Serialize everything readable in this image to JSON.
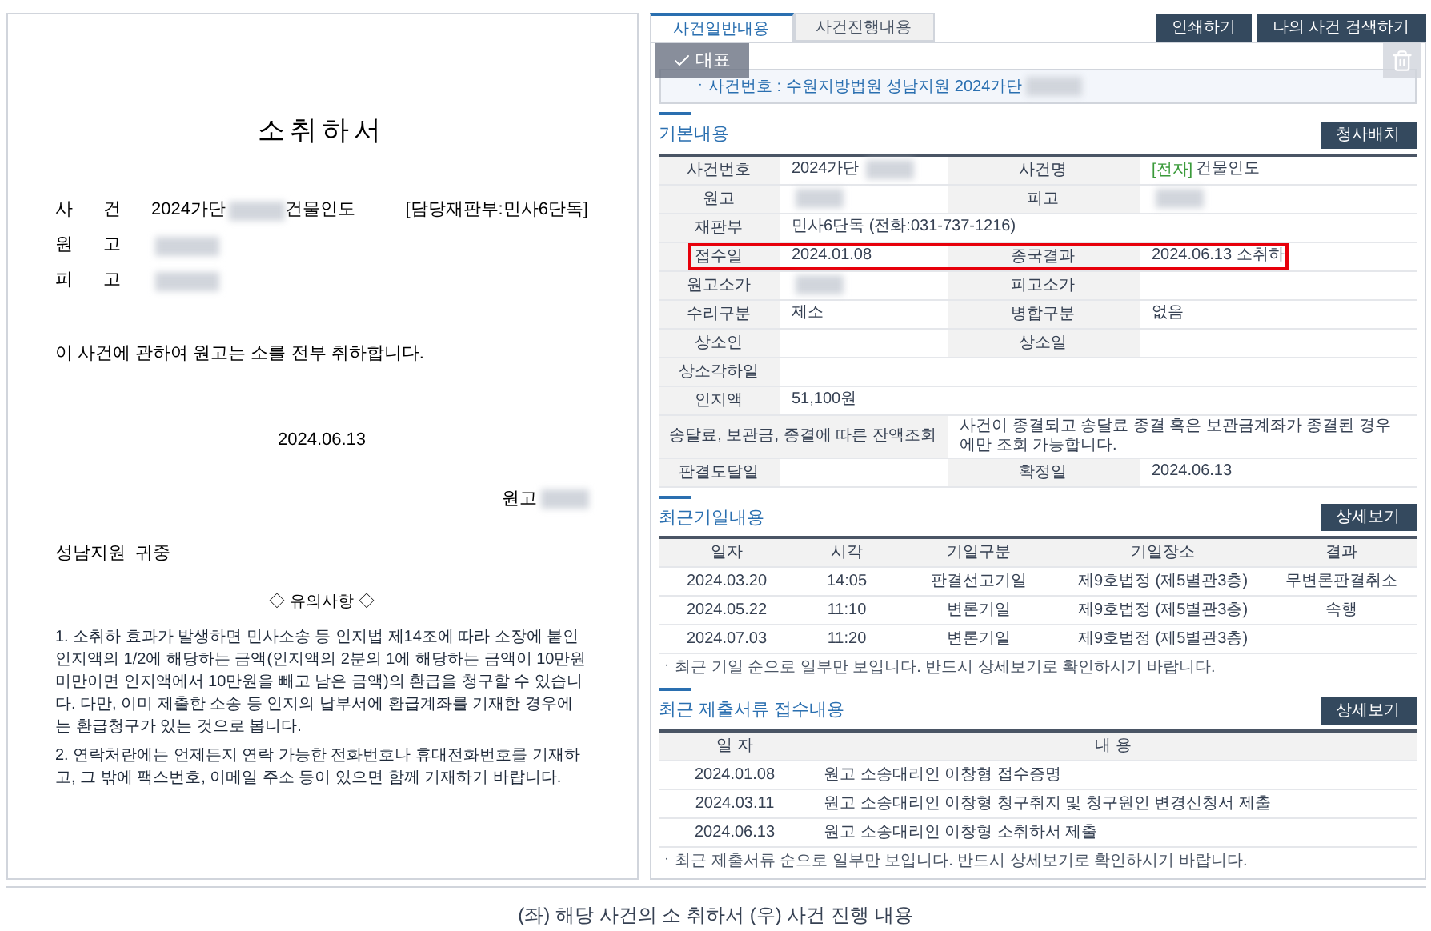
{
  "document": {
    "title": "소취하서",
    "parties": [
      {
        "label": [
          "사",
          "건"
        ],
        "value": "2024가단",
        "redacted": true,
        "suffix": "건물인도",
        "division": "[담당재판부:민사6단독]"
      },
      {
        "label": [
          "원",
          "고"
        ],
        "redacted": true
      },
      {
        "label": [
          "피",
          "고"
        ],
        "redacted": true
      }
    ],
    "body": "이 사건에 관하여 원고는 소를 전부 취하합니다.",
    "date": "2024.06.13",
    "signer": {
      "label": "원고",
      "redacted": true
    },
    "court": "성남지원  귀중",
    "notice_title": "◇ 유의사항 ◇",
    "notes": [
      "1. 소취하 효과가 발생하면 민사소송 등 인지법 제14조에 따라 소장에 붙인 인지액의 1/2에 해당하는 금액(인지액의 2분의 1에 해당하는 금액이 10만원 미만이면 인지액에서 10만원을 빼고 남은 금액)의 환급을 청구할 수 있습니다. 다만, 이미 제출한 소송 등 인지의 납부서에 환급계좌를 기재한 경우에는 환급청구가 있는 것으로 봅니다.",
      "2. 연락처란에는 언제든지 연락 가능한 전화번호나 휴대전화번호를 기재하고, 그 밖에 팩스번호, 이메일 주소 등이 있으면 함께 기재하기 바랍니다."
    ]
  },
  "case_page": {
    "tabs": [
      {
        "label": "사건일반내용",
        "selected": true
      },
      {
        "label": "사건진행내용",
        "selected": false
      }
    ],
    "buttons": [
      "인쇄하기",
      "나의 사건 검색하기"
    ],
    "overlay": {
      "label": "대표",
      "checked": true
    },
    "case_notice": {
      "text": "ㆍ사건번호 : 수원지방법원 성남지원 2024가단",
      "redacted": true
    },
    "basic": {
      "title": "기본내용",
      "button": "청사배치",
      "rows": [
        {
          "kind": "pair",
          "highlighted": false,
          "cells": [
            {
              "label": "사건번호",
              "value": "2024가단",
              "redacted": true
            },
            {
              "label": "사건명",
              "tag": "[전자]",
              "value": "건물인도",
              "redacted": false
            }
          ]
        },
        {
          "kind": "pair",
          "highlighted": false,
          "cells": [
            {
              "label": "원고",
              "redacted": true
            },
            {
              "label": "피고",
              "redacted": true
            }
          ]
        },
        {
          "kind": "full",
          "highlighted": false,
          "cells": [
            {
              "label": "재판부",
              "value": "민사6단독 (전화:031-737-1216)",
              "redacted": false
            }
          ]
        },
        {
          "kind": "pair",
          "highlighted": true,
          "cells": [
            {
              "label": "접수일",
              "value": "2024.01.08",
              "redacted": false
            },
            {
              "label": "종국결과",
              "value": "2024.06.13 소취하",
              "redacted": false
            }
          ]
        },
        {
          "kind": "pair",
          "highlighted": false,
          "cells": [
            {
              "label": "원고소가",
              "redacted": true
            },
            {
              "label": "피고소가",
              "redacted": false
            }
          ]
        },
        {
          "kind": "pair",
          "highlighted": false,
          "cells": [
            {
              "label": "수리구분",
              "value": "제소",
              "redacted": false
            },
            {
              "label": "병합구분",
              "value": "없음",
              "redacted": false
            }
          ]
        },
        {
          "kind": "pair",
          "highlighted": false,
          "cells": [
            {
              "label": "상소인",
              "redacted": false
            },
            {
              "label": "상소일",
              "redacted": false
            }
          ]
        },
        {
          "kind": "full",
          "highlighted": false,
          "cells": [
            {
              "label": "상소각하일",
              "redacted": false
            }
          ]
        },
        {
          "kind": "full",
          "highlighted": false,
          "cells": [
            {
              "label": "인지액",
              "value": "51,100원",
              "redacted": false
            }
          ]
        },
        {
          "kind": "wide",
          "highlighted": false,
          "cells": [
            {
              "label": "송달료, 보관금, 종결에 따른 잔액조회",
              "value": "사건이 종결되고 송달료 종결 혹은 보관금계좌가 종결된 경우에만 조회 가능합니다.",
              "redacted": false
            }
          ]
        },
        {
          "kind": "pair",
          "highlighted": false,
          "cells": [
            {
              "label": "판결도달일",
              "redacted": false
            },
            {
              "label": "확정일",
              "value": "2024.06.13",
              "redacted": false
            }
          ]
        }
      ]
    },
    "hearings": {
      "title": "최근기일내용",
      "button": "상세보기",
      "columns": [
        "일자",
        "시각",
        "기일구분",
        "기일장소",
        "결과"
      ],
      "rows": [
        [
          "2024.03.20",
          "14:05",
          "판결선고기일",
          "제9호법정 (제5별관3층)",
          "무변론판결취소"
        ],
        [
          "2024.05.22",
          "11:10",
          "변론기일",
          "제9호법정 (제5별관3층)",
          "속행"
        ],
        [
          "2024.07.03",
          "11:20",
          "변론기일",
          "제9호법정 (제5별관3층)",
          null
        ]
      ],
      "note": "ㆍ최근 기일 순으로 일부만 보입니다. 반드시 상세보기로 확인하시기 바랍니다."
    },
    "documents": {
      "title": "최근 제출서류 접수내용",
      "button": "상세보기",
      "columns": [
        "일 자",
        "내 용"
      ],
      "rows": [
        [
          "2024.01.08",
          "원고 소송대리인 이창형 접수증명"
        ],
        [
          "2024.03.11",
          "원고 소송대리인 이창형 청구취지 및 청구원인 변경신청서 제출"
        ],
        [
          "2024.06.13",
          "원고 소송대리인 이창형 소취하서 제출"
        ]
      ],
      "note": "ㆍ최근 제출서류 순으로 일부만 보입니다. 반드시 상세보기로 확인하시기 바랍니다."
    }
  },
  "caption": "(좌) 해당 사건의 소 취하서 (우) 사건 진행 내용"
}
